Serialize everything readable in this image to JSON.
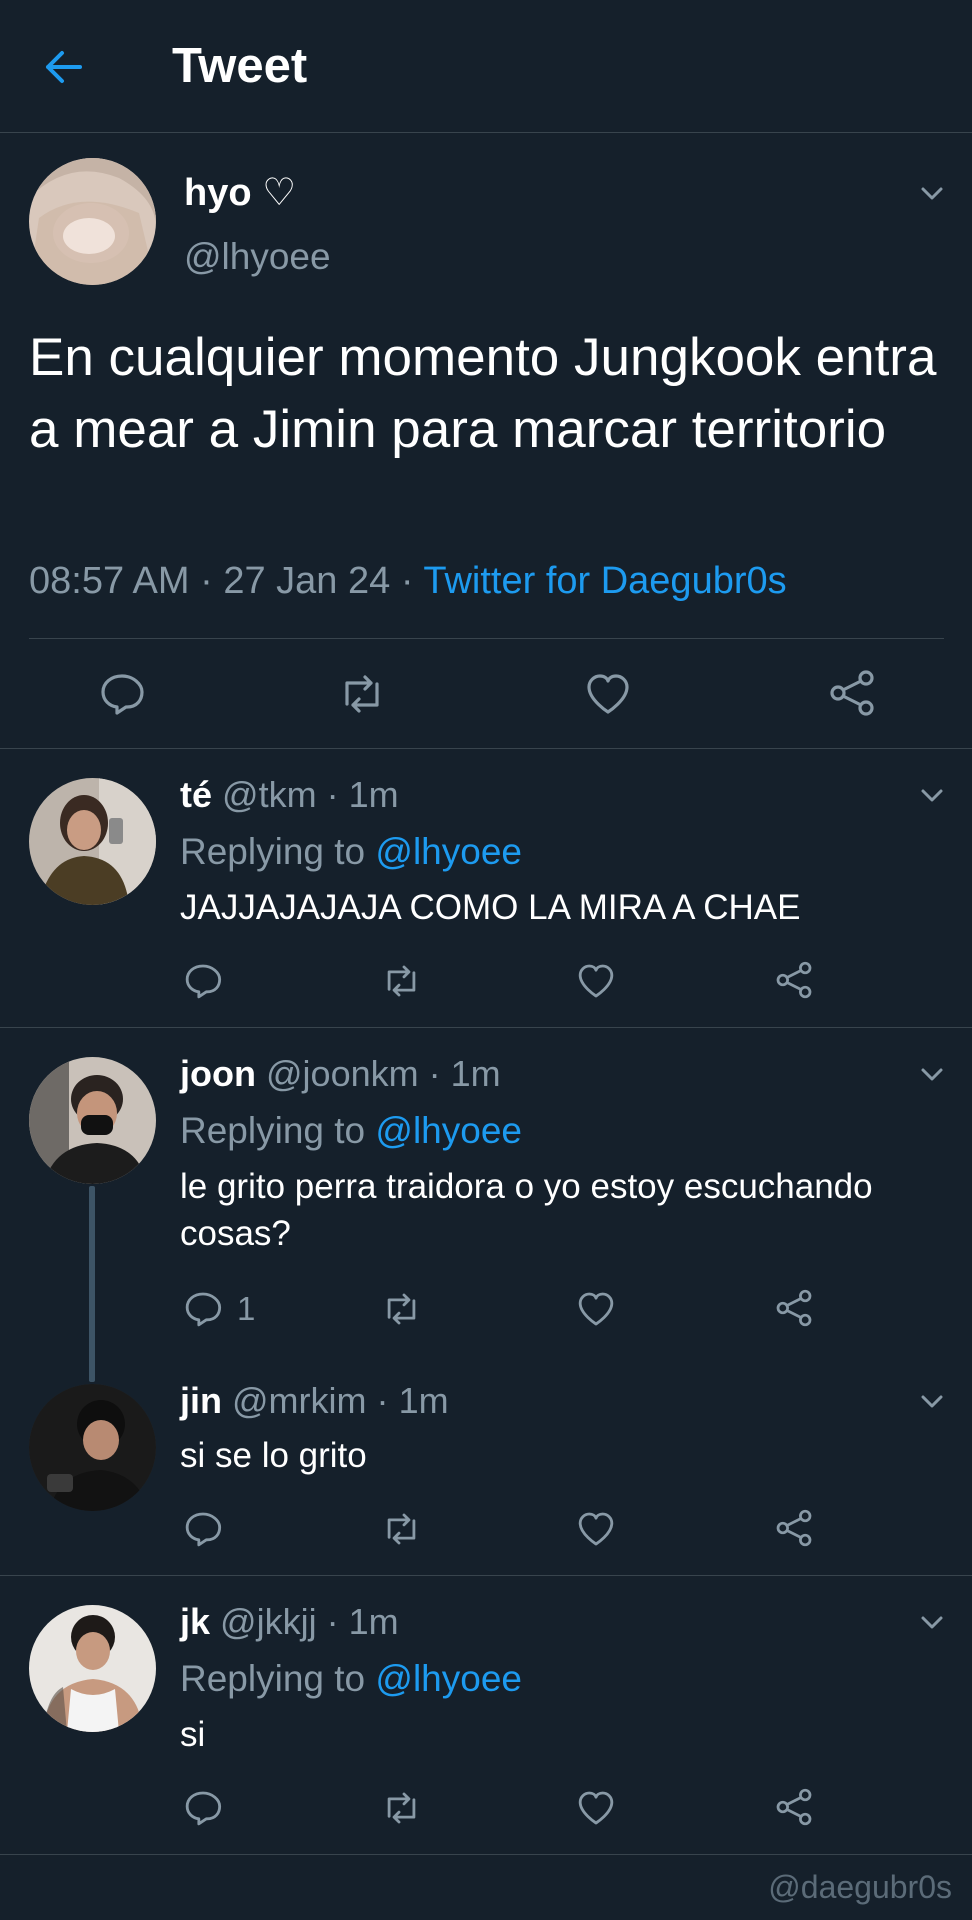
{
  "header": {
    "title": "Tweet",
    "back_icon": "arrow-left-icon",
    "accent": "#1d9bf0"
  },
  "main_tweet": {
    "display_name": "hyo ♡",
    "handle": "@lhyoee",
    "text": "En cualquier momento Jungkook entra a mear a Jimin para marcar territorio",
    "time": "08:57 AM",
    "sep1": "·",
    "date": "27 Jan 24",
    "sep2": "·",
    "source": "Twitter for Daegubr0s"
  },
  "replies": [
    {
      "name": "té",
      "handle": "@tkm",
      "dot": "·",
      "time": "1m",
      "replying_label": "Replying to",
      "replying_handle": "@lhyoee",
      "text": "JAJJAJAJAJA COMO LA MIRA A CHAE"
    },
    {
      "name": "joon",
      "handle": "@joonkm",
      "dot": "·",
      "time": "1m",
      "replying_label": "Replying to",
      "replying_handle": "@lhyoee",
      "text": "le grito perra traidora o yo estoy escuchando cosas?",
      "reply_count": "1"
    },
    {
      "name": "jin",
      "handle": "@mrkim",
      "dot": "·",
      "time": "1m",
      "text": "si se lo grito"
    },
    {
      "name": "jk",
      "handle": "@jkkjj",
      "dot": "·",
      "time": "1m",
      "replying_label": "Replying to",
      "replying_handle": "@lhyoee",
      "text": "si"
    }
  ],
  "watermark": "@daegubr0s",
  "colors": {
    "background": "#15202b",
    "border": "#38444d",
    "muted": "#8899a6",
    "link": "#1d9bf0"
  }
}
